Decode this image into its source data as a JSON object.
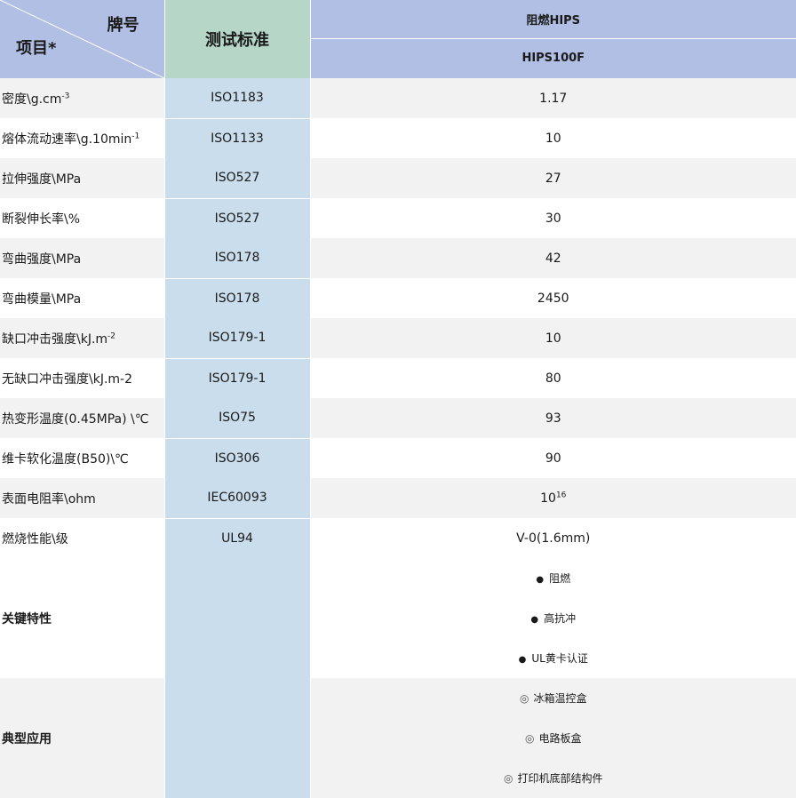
{
  "header": {
    "brand_label": "牌号",
    "item_label": "项目",
    "item_asterisk": "*",
    "standard_label": "测试标准",
    "group_label": "阻燃HIPS",
    "grade_label": "HIPS100F"
  },
  "rows": [
    {
      "name": "密度\\g.cm",
      "sup": "-3",
      "standard": "ISO1183",
      "value": "1.17",
      "value_sup": ""
    },
    {
      "name": "熔体流动速率\\g.10min",
      "sup": "-1",
      "standard": "ISO1133",
      "value": "10",
      "value_sup": ""
    },
    {
      "name": "拉伸强度\\MPa",
      "sup": "",
      "standard": "ISO527",
      "value": "27",
      "value_sup": ""
    },
    {
      "name": "断裂伸长率\\%",
      "sup": "",
      "standard": "ISO527",
      "value": "30",
      "value_sup": ""
    },
    {
      "name": "弯曲强度\\MPa",
      "sup": "",
      "standard": "ISO178",
      "value": "42",
      "value_sup": ""
    },
    {
      "name": "弯曲模量\\MPa",
      "sup": "",
      "standard": "ISO178",
      "value": "2450",
      "value_sup": ""
    },
    {
      "name": "缺口冲击强度\\kJ.m",
      "sup": "-2",
      "standard": "ISO179-1",
      "value": "10",
      "value_sup": ""
    },
    {
      "name": "无缺口冲击强度\\kJ.m-2",
      "sup": "",
      "standard": "ISO179-1",
      "value": "80",
      "value_sup": ""
    },
    {
      "name": "热变形温度(0.45MPa) \\℃",
      "sup": "",
      "standard": "ISO75",
      "value": "93",
      "value_sup": ""
    },
    {
      "name": "维卡软化温度(B50)\\℃",
      "sup": "",
      "standard": "ISO306",
      "value": "90",
      "value_sup": ""
    },
    {
      "name": "表面电阻率\\ohm",
      "sup": "",
      "standard": "IEC60093",
      "value": "10",
      "value_sup": "16"
    },
    {
      "name": "燃烧性能\\级",
      "sup": "",
      "standard": "UL94",
      "value": "V-0(1.6mm)",
      "value_sup": ""
    }
  ],
  "key_features": {
    "title": "关键特性",
    "bullet": "●",
    "items": [
      "阻燃",
      "高抗冲",
      "UL黄卡认证"
    ]
  },
  "applications": {
    "title": "典型应用",
    "bullet": "◎",
    "items": [
      "冰箱温控盒",
      "电路板盒",
      "打印机底部结构件"
    ]
  }
}
